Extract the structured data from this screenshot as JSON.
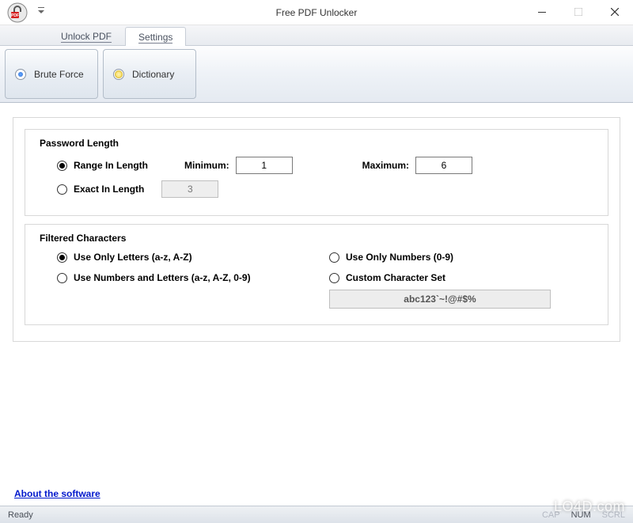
{
  "window": {
    "title": "Free PDF Unlocker",
    "icons": {
      "app": "pdf-lock-icon",
      "qat": "dropdown-marker"
    }
  },
  "tabs": {
    "unlock": "Unlock PDF",
    "settings": "Settings"
  },
  "ribbon": {
    "brute_force": "Brute Force",
    "dictionary": "Dictionary"
  },
  "password_length": {
    "title": "Password Length",
    "range_label": "Range In Length",
    "min_label": "Minimum:",
    "min_value": "1",
    "max_label": "Maximum:",
    "max_value": "6",
    "exact_label": "Exact In Length",
    "exact_value": "3"
  },
  "filtered_chars": {
    "title": "Filtered Characters",
    "only_letters": "Use Only Letters (a-z, A-Z)",
    "only_numbers": "Use Only Numbers (0-9)",
    "numbers_letters": "Use Numbers and Letters (a-z, A-Z, 0-9)",
    "custom": "Custom Character Set",
    "custom_value": "abc123`~!@#$%"
  },
  "footer": {
    "about": "About the software"
  },
  "status": {
    "ready": "Ready",
    "cap": "CAP",
    "num": "NUM",
    "scrl": "SCRL"
  },
  "watermark": "LO4D.com"
}
